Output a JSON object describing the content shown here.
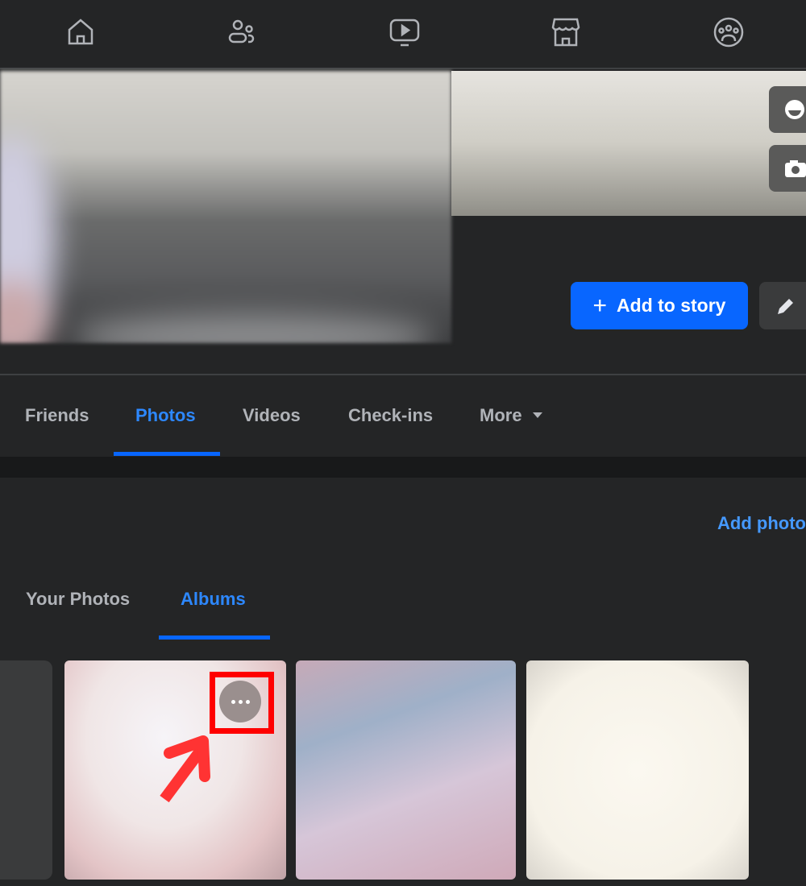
{
  "nav": {
    "items": [
      "home-icon",
      "friends-icon",
      "watch-icon",
      "marketplace-icon",
      "groups-icon"
    ]
  },
  "profile": {
    "add_to_story": "Add to story"
  },
  "tabs": [
    {
      "label": "Friends",
      "active": false
    },
    {
      "label": "Photos",
      "active": true
    },
    {
      "label": "Videos",
      "active": false
    },
    {
      "label": "Check-ins",
      "active": false
    },
    {
      "label": "More",
      "active": false
    }
  ],
  "photos": {
    "add_photos": "Add photo",
    "subtabs": [
      {
        "label": "Your Photos",
        "active": false
      },
      {
        "label": "Albums",
        "active": true
      }
    ]
  },
  "colors": {
    "accent": "#0866ff",
    "annotation": "#ff0000"
  }
}
